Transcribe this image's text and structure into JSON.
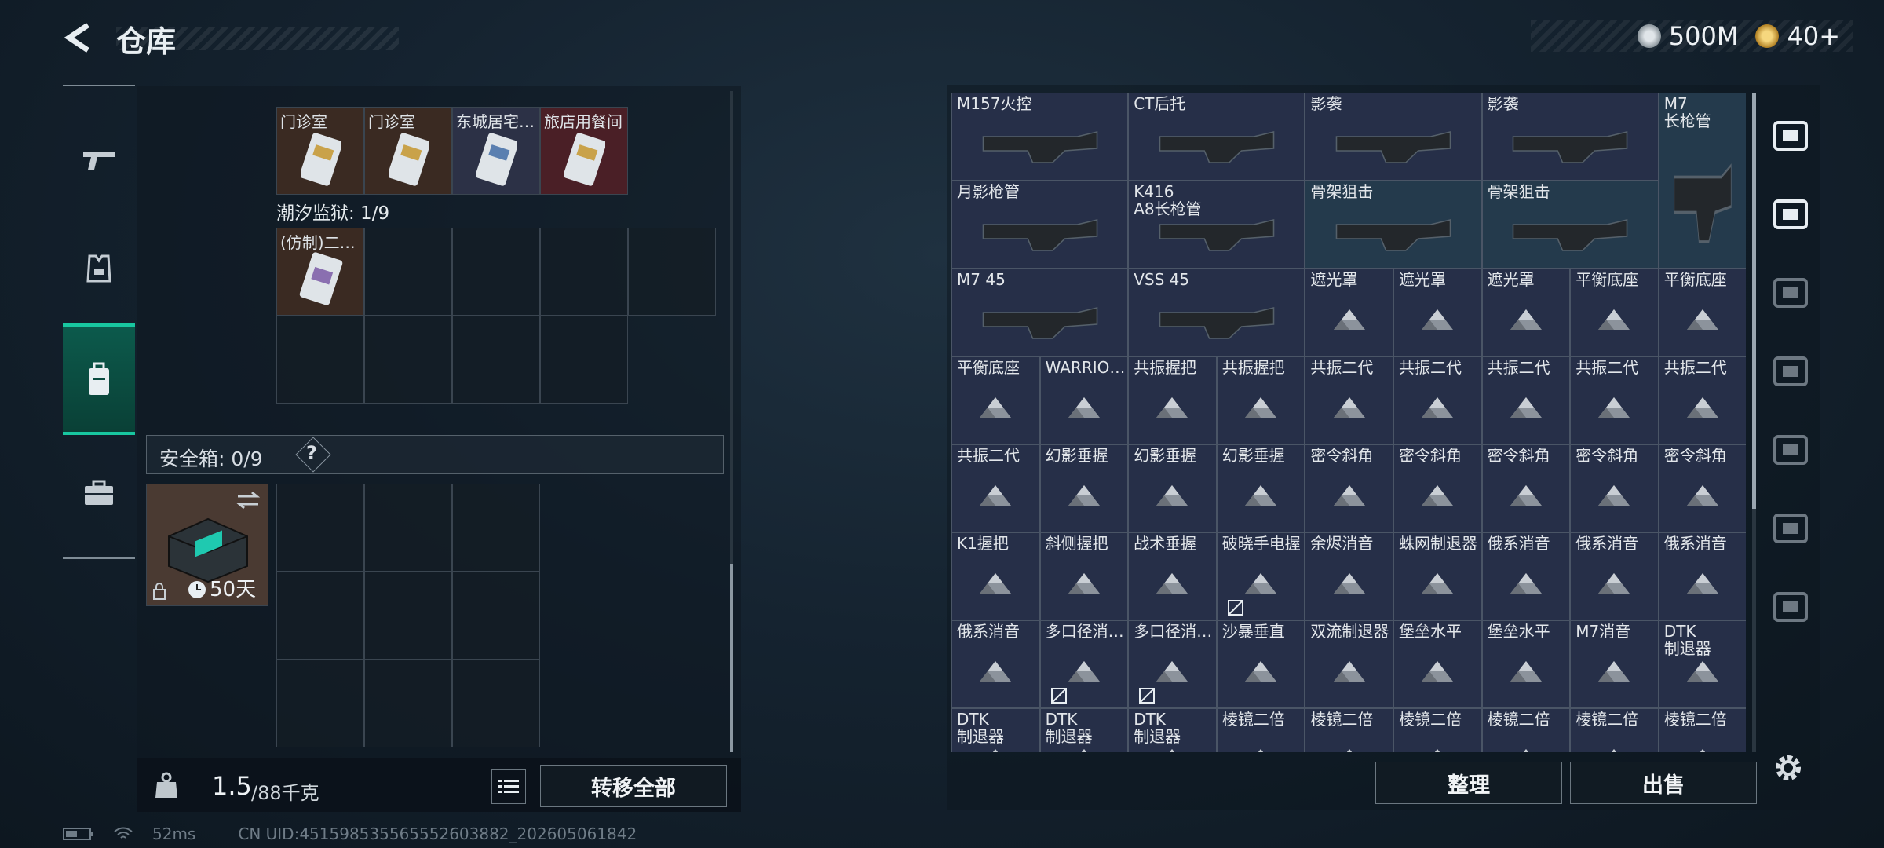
{
  "header": {
    "title": "仓库"
  },
  "currency": [
    {
      "icon": "silver-coin-icon",
      "value": "500M",
      "color": "#b9c2c9"
    },
    {
      "icon": "gold-coin-icon",
      "value": "40+",
      "color": "#d8a94a"
    }
  ],
  "left_nav": [
    {
      "icon": "pistol-icon",
      "active": false
    },
    {
      "icon": "armor-vest-icon",
      "active": false
    },
    {
      "icon": "backpack-icon",
      "active": true
    },
    {
      "icon": "briefcase-icon",
      "active": false
    }
  ],
  "left_inventory": {
    "top_items": [
      "门诊室",
      "门诊室",
      "东城居宅…",
      "旅店用餐间"
    ],
    "prison_label": "潮汐监狱: 1/9",
    "prison_items": [
      "(仿制)二…"
    ],
    "safe_label": "安全箱: 0/9",
    "safe_help": "?",
    "safe_days": "50天",
    "weight_value": "1.5",
    "weight_capacity": "/88千克",
    "transfer_all": "转移全部"
  },
  "right_grid": {
    "large_items": [
      {
        "label": "M157火控"
      },
      {
        "label": "CT后托"
      },
      {
        "label": "影袭"
      },
      {
        "label": "影袭"
      },
      {
        "label": "M7\n长枪管"
      },
      {
        "label": "月影枪管"
      },
      {
        "label": "K416\nA8长枪管"
      },
      {
        "label": "骨架狙击"
      },
      {
        "label": "骨架狙击"
      },
      {
        "label": "M7 45"
      },
      {
        "label": "VSS 45"
      }
    ],
    "small_items": [
      "遮光罩",
      "遮光罩",
      "遮光罩",
      "平衡底座",
      "平衡底座",
      "平衡底座",
      "WARRIO…",
      "共振握把",
      "共振握把",
      "共振二代",
      "共振二代",
      "共振二代",
      "共振二代",
      "共振二代",
      "共振二代",
      "幻影垂握",
      "幻影垂握",
      "幻影垂握",
      "密令斜角",
      "密令斜角",
      "密令斜角",
      "密令斜角",
      "密令斜角",
      "K1握把",
      "斜侧握把",
      "战术垂握",
      "破晓手电握",
      "余烬消音",
      "蛛网制退器",
      "俄系消音",
      "俄系消音",
      "俄系消音",
      "俄系消音",
      "多口径消…",
      "多口径消…",
      "沙暴垂直",
      "双流制退器",
      "堡垒水平",
      "堡垒水平",
      "M7消音",
      "DTK\n制退器",
      "DTK\n制退器",
      "DTK\n制退器",
      "DTK\n制退器",
      "棱镜二倍",
      "棱镜二倍",
      "棱镜二倍",
      "棱镜二倍",
      "棱镜二倍",
      "棱镜二倍"
    ]
  },
  "right_nav": [
    "helmet-icon",
    "gti-rifle-icon",
    "iv-folder-icon",
    "gti-triangle-icon",
    "gti-card-icon",
    "gti-cursor-icon",
    "iv-add-icon"
  ],
  "actions": {
    "arrange": "整理",
    "sell": "出售"
  },
  "status": {
    "ping": "52ms",
    "uid": "CN UID:451598535565552603882_202605061842"
  }
}
